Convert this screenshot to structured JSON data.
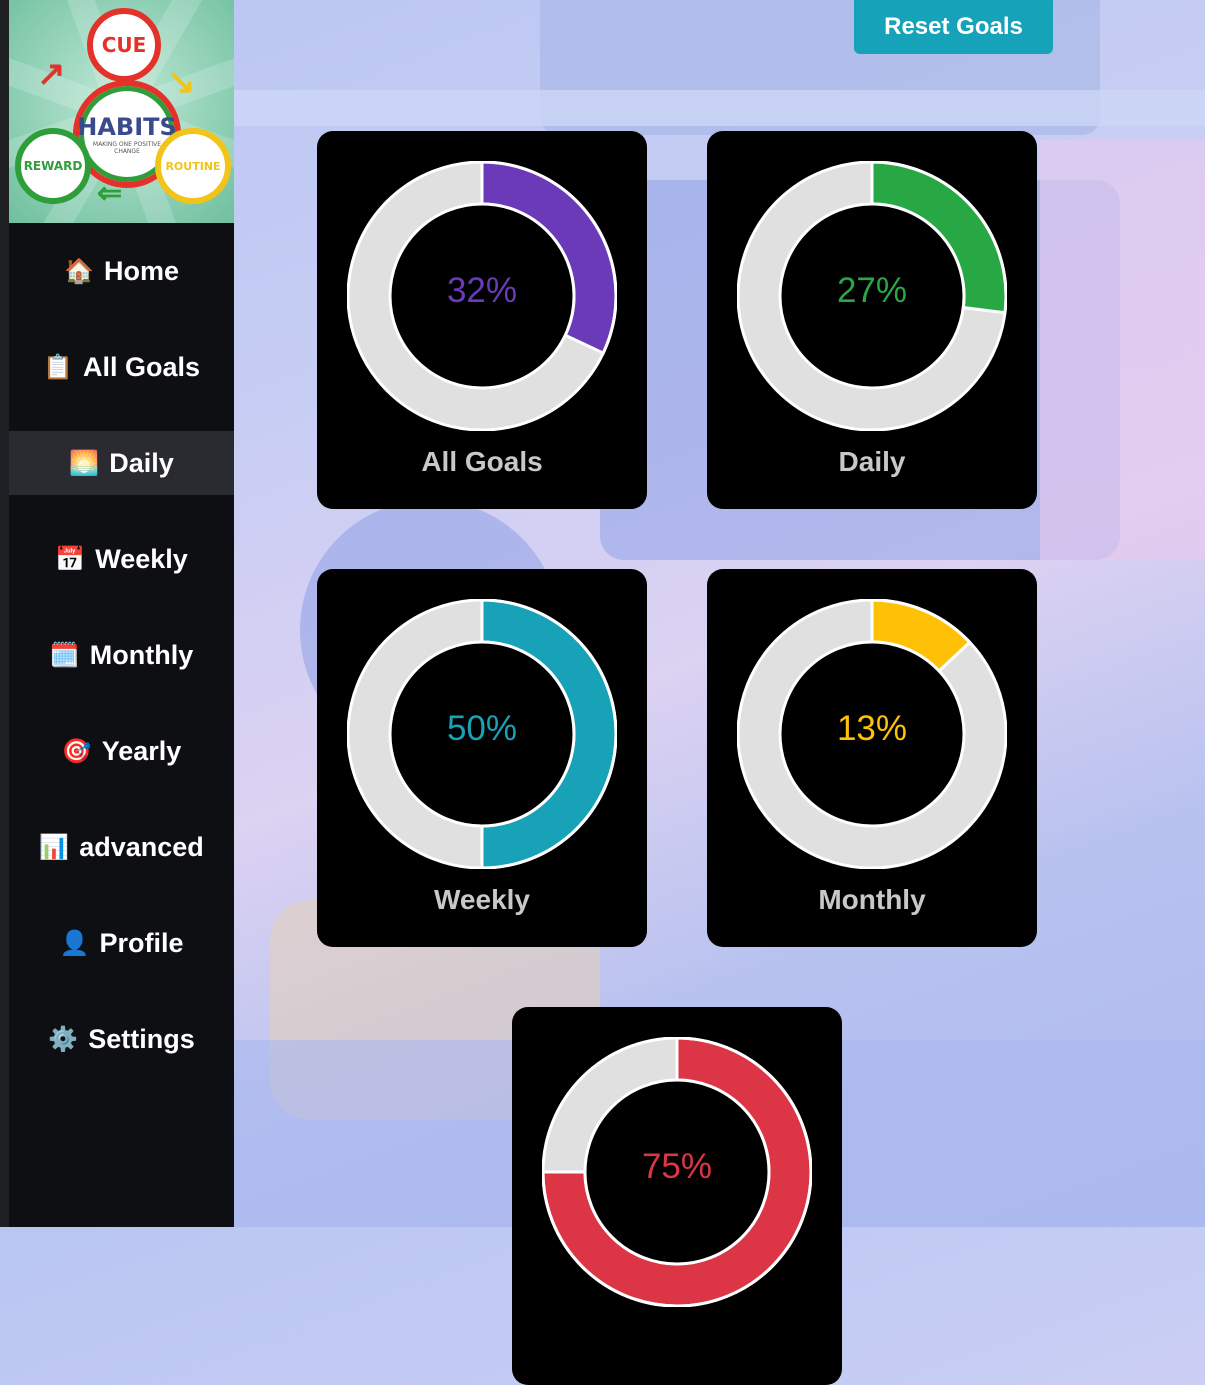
{
  "sidebar": {
    "logo": {
      "cue": "CUE",
      "habits": "HABITS",
      "habits_sub": "MAKING ONE POSITIVE CHANGE",
      "reward": "REWARD",
      "routine": "ROUTINE"
    },
    "items": [
      {
        "label": "Home",
        "icon": "🏠",
        "icon_name": "home-icon",
        "active": false
      },
      {
        "label": "All Goals",
        "icon": "📋",
        "icon_name": "clipboard-icon",
        "active": false
      },
      {
        "label": "Daily",
        "icon": "🌅",
        "icon_name": "sunrise-icon",
        "active": true
      },
      {
        "label": "Weekly",
        "icon": "📅",
        "icon_name": "calendar-icon",
        "active": false
      },
      {
        "label": "Monthly",
        "icon": "🗓️",
        "icon_name": "spiral-calendar-icon",
        "active": false
      },
      {
        "label": "Yearly",
        "icon": "🎯",
        "icon_name": "target-icon",
        "active": false
      },
      {
        "label": "advanced",
        "icon": "📊",
        "icon_name": "bar-chart-icon",
        "active": false
      },
      {
        "label": "Profile",
        "icon": "👤",
        "icon_name": "user-icon",
        "active": false
      },
      {
        "label": "Settings",
        "icon": "⚙️",
        "icon_name": "gear-icon",
        "active": false
      }
    ]
  },
  "toolbar": {
    "reset_label": "Reset Goals"
  },
  "colors": {
    "track": "#e0e0e0",
    "all_goals": "#6a3ab8",
    "daily": "#28a745",
    "weekly": "#17a2b8",
    "monthly": "#ffc107",
    "yearly": "#dc3545"
  },
  "chart_data": [
    {
      "type": "pie",
      "name": "All Goals",
      "percent": 32,
      "label": "32%",
      "color": "#6a3ab8"
    },
    {
      "type": "pie",
      "name": "Daily",
      "percent": 27,
      "label": "27%",
      "color": "#28a745"
    },
    {
      "type": "pie",
      "name": "Weekly",
      "percent": 50,
      "label": "50%",
      "color": "#17a2b8"
    },
    {
      "type": "pie",
      "name": "Monthly",
      "percent": 13,
      "label": "13%",
      "color": "#ffc107"
    },
    {
      "type": "pie",
      "name": "",
      "percent": 75,
      "label": "75%",
      "color": "#dc3545"
    }
  ]
}
